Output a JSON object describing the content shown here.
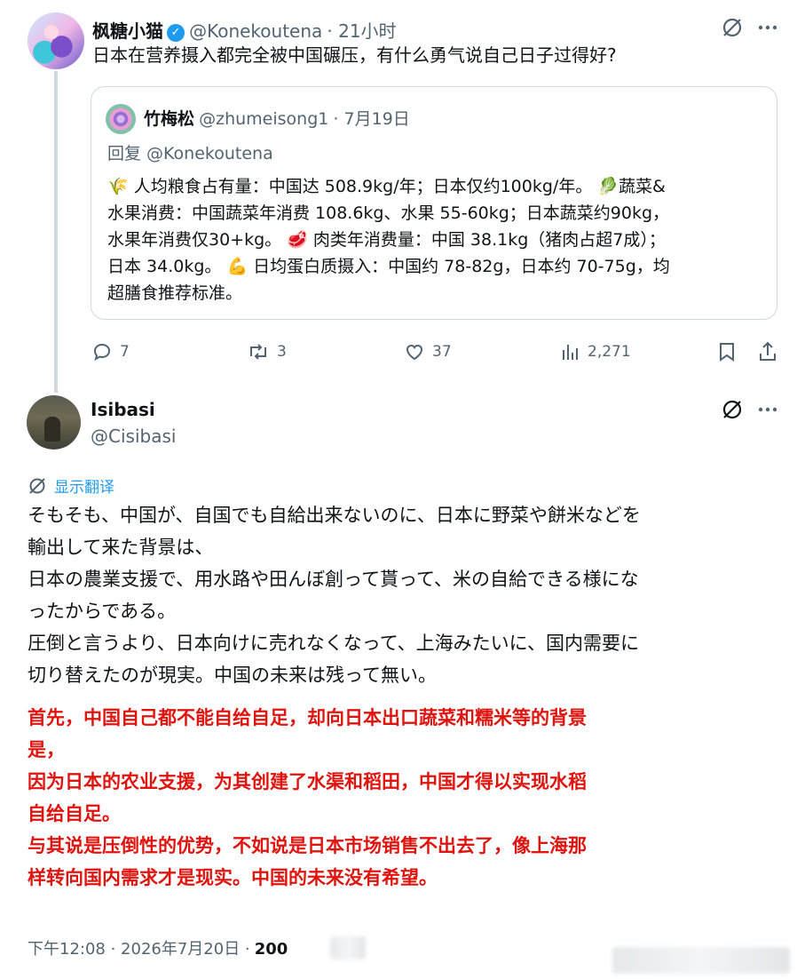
{
  "first_tweet": {
    "display_name": "枫糖小猫",
    "verified_mark": "✓",
    "handle": "@Konekoutena",
    "time": "· 21小时",
    "text": "日本在营养摄入都完全被中国碾压，有什么勇气说自己日子过得好?",
    "quote": {
      "display_name": "竹梅松",
      "handle": "@zhumeisong1",
      "date": "· 7月19日",
      "reply_to": "回复 @Konekoutena",
      "lines": [
        "🌾 人均粮食占有量：中国达 508.9kg/年；日本仅约100kg/年。 🥬蔬菜&",
        "水果消费：中国蔬菜年消费 108.6kg、水果 55-60kg；日本蔬菜约90kg，",
        "水果年消费仅30+kg。 🥩 肉类年消费量：中国 38.1kg（猪肉占超7成）；",
        "日本 34.0kg。 💪 日均蛋白质摄入：中国约 78-82g，日本约 70-75g，均",
        "超膳食推荐标准。"
      ]
    },
    "actions": {
      "replies": "7",
      "retweets": "3",
      "likes": "37",
      "views": "2,271"
    }
  },
  "second_tweet": {
    "display_name": "Isibasi",
    "handle": "@Cisibasi",
    "translate_label": "显示翻译",
    "jp_lines": [
      "そもそも、中国が、自国でも自給出来ないのに、日本に野菜や餅米などを",
      "輸出して来た背景は、",
      "日本の農業支援で、用水路や田んぼ創って貰って、米の自給できる様にな",
      "ったからである。",
      "圧倒と言うより、日本向けに売れなくなって、上海みたいに、国内需要に",
      "切り替えたのが現実。中国の未来は残って無い。"
    ],
    "translation_lines": [
      "首先，中国自己都不能自给自足，却向日本出口蔬菜和糯米等的背景",
      "是，",
      "因为日本的农业支援，为其创建了水渠和稻田，中国才得以实现水稻",
      "自给自足。",
      "与其说是压倒性的优势，不如说是日本市场销售不出去了，像上海那",
      "样转向国内需求才是现实。中国的未来没有希望。"
    ],
    "footer_time": "下午12:08 · 2026年7月20日 ·",
    "footer_views": "200"
  },
  "colors": {
    "accent": "#1d9bf0",
    "muted": "#536471",
    "border": "#cfd9de",
    "annotation_red": "#e0140f"
  },
  "icons": [
    "grok-icon",
    "more-icon",
    "reply-icon",
    "retweet-icon",
    "like-icon",
    "views-icon",
    "bookmark-icon",
    "share-icon",
    "translate-icon",
    "verified-icon"
  ]
}
